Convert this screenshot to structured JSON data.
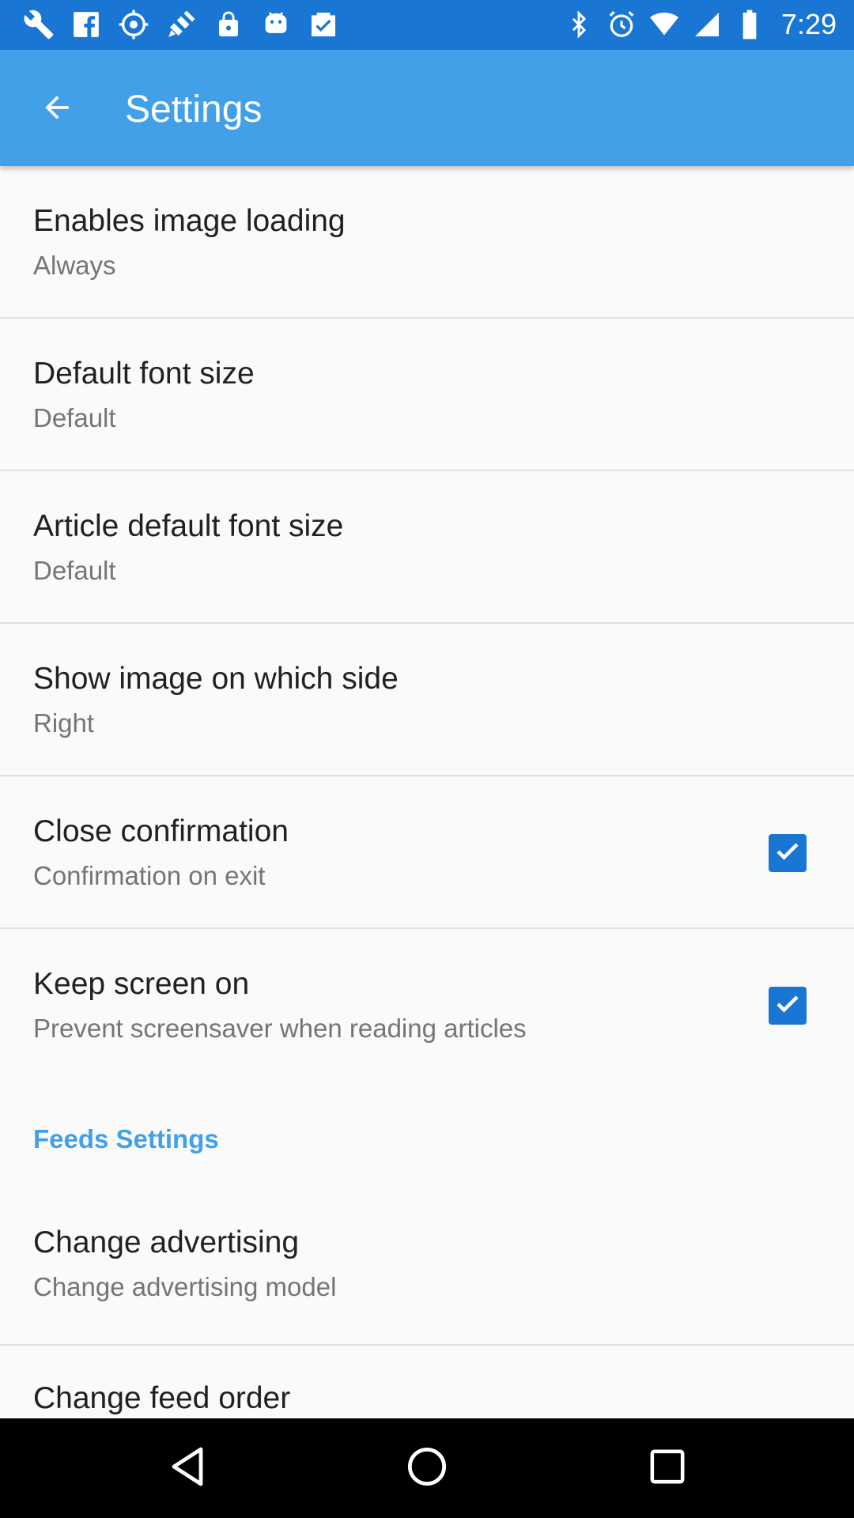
{
  "status_bar": {
    "time": "7:29",
    "left_icons": [
      "wrench-icon",
      "facebook-icon",
      "fake-gps-icon",
      "satellite-icon",
      "lock-icon",
      "android-icon",
      "clipboard-check-icon"
    ],
    "right_icons": [
      "bluetooth-icon",
      "alarm-icon",
      "wifi-icon",
      "signal-icon",
      "battery-icon"
    ]
  },
  "app_bar": {
    "title": "Settings",
    "back_icon": "arrow-back-icon"
  },
  "preferences": [
    {
      "title": "Enables image loading",
      "summary": "Always"
    },
    {
      "title": "Default font size",
      "summary": "Default"
    },
    {
      "title": "Article default font size",
      "summary": "Default"
    },
    {
      "title": "Show image on which side",
      "summary": "Right"
    },
    {
      "title": "Close confirmation",
      "summary": "Confirmation on exit",
      "checked": true
    },
    {
      "title": "Keep screen on",
      "summary": "Prevent screensaver when reading articles",
      "checked": true
    }
  ],
  "feeds_section": {
    "title": "Feeds Settings",
    "items": [
      {
        "title": "Change advertising",
        "summary": "Change advertising model"
      },
      {
        "title": "Change feed order"
      }
    ]
  },
  "nav_bar": {
    "icons": [
      "back-triangle-icon",
      "home-circle-icon",
      "recents-square-icon"
    ]
  },
  "colors": {
    "status_bar": "#1976d2",
    "app_bar": "#42a0e8",
    "accent": "#42a0e8",
    "checkbox": "#1976d2"
  }
}
